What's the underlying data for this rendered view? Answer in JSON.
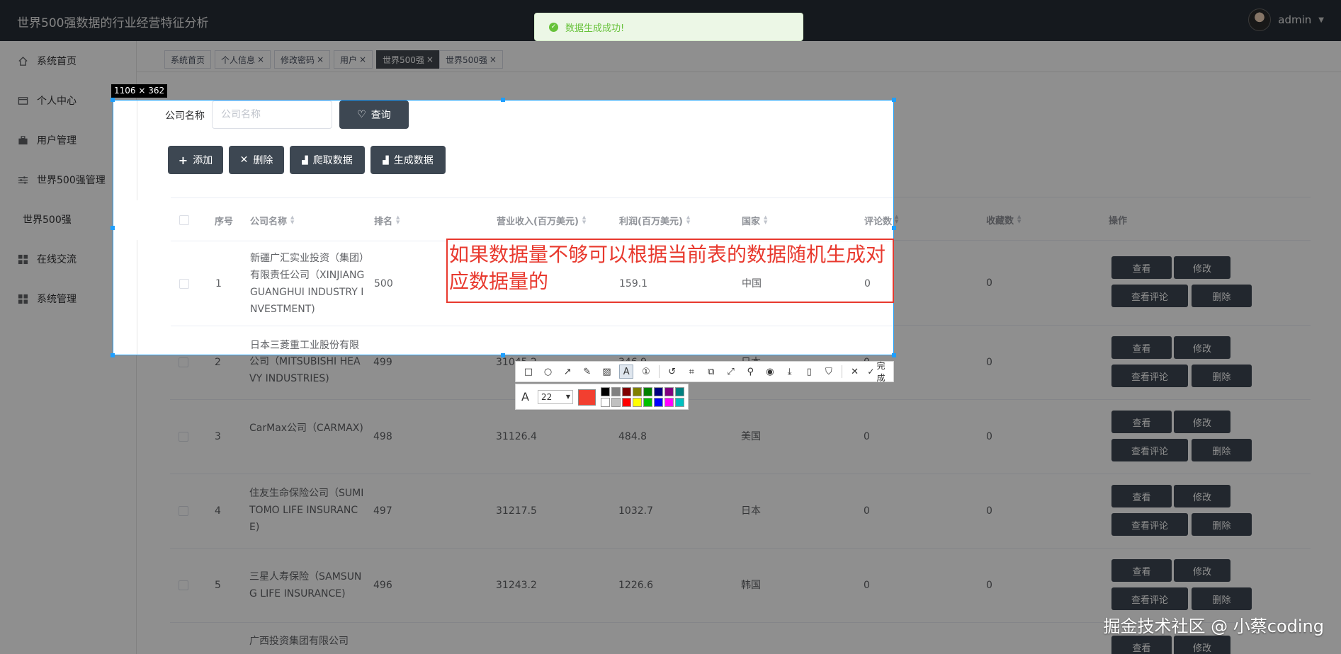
{
  "app": {
    "title": "世界500强数据的行业经营特征分析",
    "user": "admin"
  },
  "toast": {
    "message": "数据生成成功!"
  },
  "sidebar": {
    "items": [
      {
        "label": "系统首页",
        "icon": "home-icon"
      },
      {
        "label": "个人中心",
        "icon": "id-card-icon"
      },
      {
        "label": "用户管理",
        "icon": "briefcase-icon"
      },
      {
        "label": "世界500强管理",
        "icon": "sliders-icon"
      },
      {
        "label": "世界500强",
        "icon": ""
      },
      {
        "label": "在线交流",
        "icon": "grid-icon"
      },
      {
        "label": "系统管理",
        "icon": "grid-icon"
      }
    ]
  },
  "tags": [
    {
      "label": "系统首页",
      "closable": false
    },
    {
      "label": "个人信息",
      "closable": true
    },
    {
      "label": "修改密码",
      "closable": true
    },
    {
      "label": "用户",
      "closable": true
    },
    {
      "label": "世界500强",
      "closable": true,
      "active": true
    },
    {
      "label": "世界500强",
      "closable": true
    }
  ],
  "search": {
    "label": "公司名称",
    "placeholder": "公司名称",
    "button": "查询"
  },
  "actions": {
    "add": "添加",
    "delete": "删除",
    "crawl": "爬取数据",
    "generate": "生成数据"
  },
  "table": {
    "columns": [
      "序号",
      "公司名称",
      "排名",
      "营业收入(百万美元)",
      "利润(百万美元)",
      "国家",
      "评论数",
      "收藏数",
      "操作"
    ],
    "rows": [
      {
        "index": "1",
        "name": "新疆广汇实业投资（集团）有限责任公司（XINJIANG GUANGHUI INDUSTRY INVESTMENT)",
        "rank": "500",
        "revenue": "",
        "profit": "159.1",
        "country": "中国",
        "comments": "0",
        "favorites": "0"
      },
      {
        "index": "2",
        "name": "日本三菱重工业股份有限公司（MITSUBISHI HEAVY INDUSTRIES)",
        "rank": "499",
        "revenue": "31045.2",
        "profit": "346.9",
        "country": "日本",
        "comments": "0",
        "favorites": "0"
      },
      {
        "index": "3",
        "name": "CarMax公司（CARMAX)",
        "rank": "498",
        "revenue": "31126.4",
        "profit": "484.8",
        "country": "美国",
        "comments": "0",
        "favorites": "0"
      },
      {
        "index": "4",
        "name": "住友生命保险公司（SUMITOMO LIFE INSURANCE)",
        "rank": "497",
        "revenue": "31217.5",
        "profit": "1032.7",
        "country": "日本",
        "comments": "0",
        "favorites": "0"
      },
      {
        "index": "5",
        "name": "三星人寿保险（SAMSUNG LIFE INSURANCE)",
        "rank": "496",
        "revenue": "31243.2",
        "profit": "1226.6",
        "country": "韩国",
        "comments": "0",
        "favorites": "0"
      },
      {
        "index": "",
        "name": "广西投资集团有限公司",
        "rank": "",
        "revenue": "",
        "profit": "",
        "country": "",
        "comments": "",
        "favorites": ""
      }
    ],
    "ops": {
      "view": "查看",
      "edit": "修改",
      "view_comments": "查看评论",
      "delete": "删除"
    }
  },
  "capture": {
    "size_label": "1106 × 362",
    "annotation": "如果数据量不够可以根据当前表的数据随机生成对应数据量的",
    "font_size": "22",
    "done_label": "完成",
    "annotation_color": "#f23f30",
    "palette": [
      "#000000",
      "#808080",
      "#800000",
      "#808000",
      "#008000",
      "#000080",
      "#800080",
      "#008080",
      "#ffffff",
      "#c0c0c0",
      "#ff0000",
      "#ffff00",
      "#00c000",
      "#0000ff",
      "#ff00ff",
      "#00c0c0"
    ]
  },
  "watermark": "掘金技术社区 @ 小蔡coding"
}
